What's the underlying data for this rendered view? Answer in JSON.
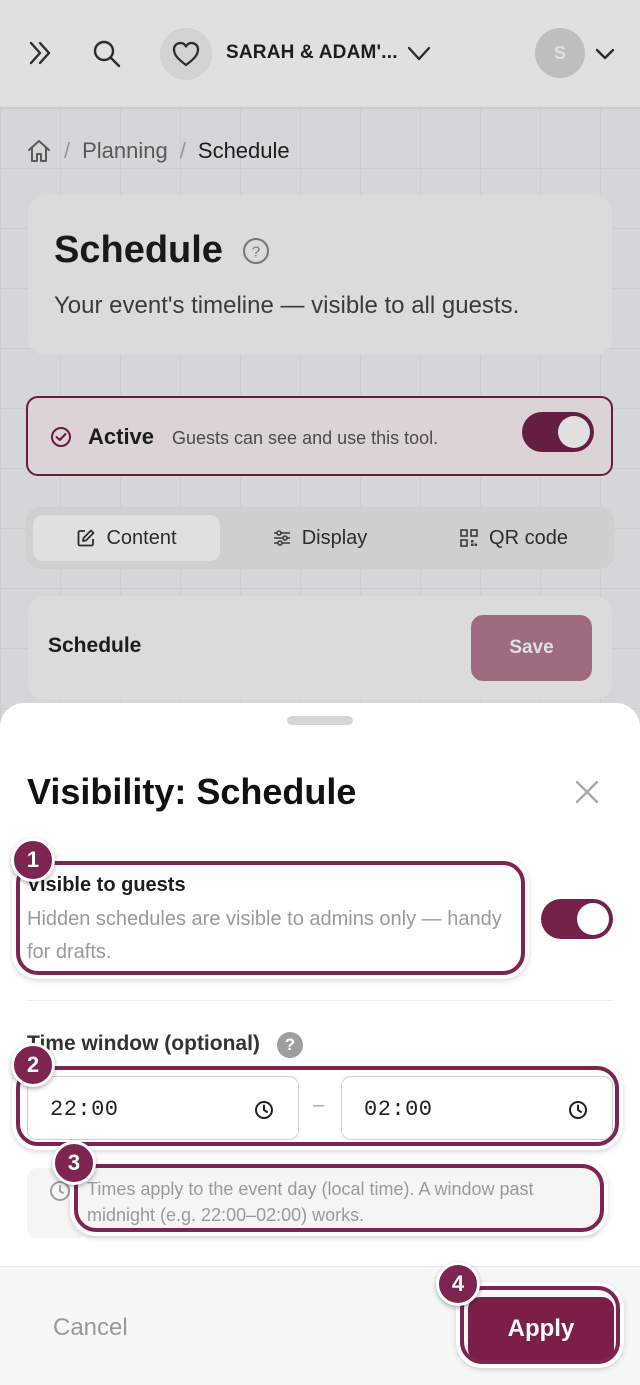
{
  "topbar": {
    "event_name": "SARAH & ADAM'...",
    "avatar_initial": "S"
  },
  "breadcrumb": {
    "items": [
      "Planning",
      "Schedule"
    ]
  },
  "page": {
    "title": "Schedule",
    "subtitle": "Your event's timeline — visible to all guests."
  },
  "status": {
    "label": "Active",
    "description": "Guests can see and use this tool.",
    "enabled": true
  },
  "tabs": [
    {
      "label": "Content",
      "icon": "edit-icon",
      "selected": true
    },
    {
      "label": "Display",
      "icon": "sliders-icon",
      "selected": false
    },
    {
      "label": "QR code",
      "icon": "qr-code-icon",
      "selected": false
    }
  ],
  "section": {
    "label": "Schedule",
    "save_label": "Save"
  },
  "sheet": {
    "title": "Visibility: Schedule",
    "visible": {
      "label": "Visible to guests",
      "description": "Hidden schedules are visible to admins only — handy for drafts.",
      "enabled": true
    },
    "time_window": {
      "label": "Time window (optional)",
      "help": "?",
      "start": "22:00",
      "end": "02:00",
      "separator": "–",
      "note": "Times apply to the event day (local time). A window past midnight (e.g. 22:00–02:00) works."
    },
    "cancel_label": "Cancel",
    "apply_label": "Apply"
  },
  "annotations": [
    "1",
    "2",
    "3",
    "4"
  ],
  "colors": {
    "brand": "#7b1f4a",
    "brand_muted": "#b47a94",
    "annotation": "#7d2450"
  }
}
